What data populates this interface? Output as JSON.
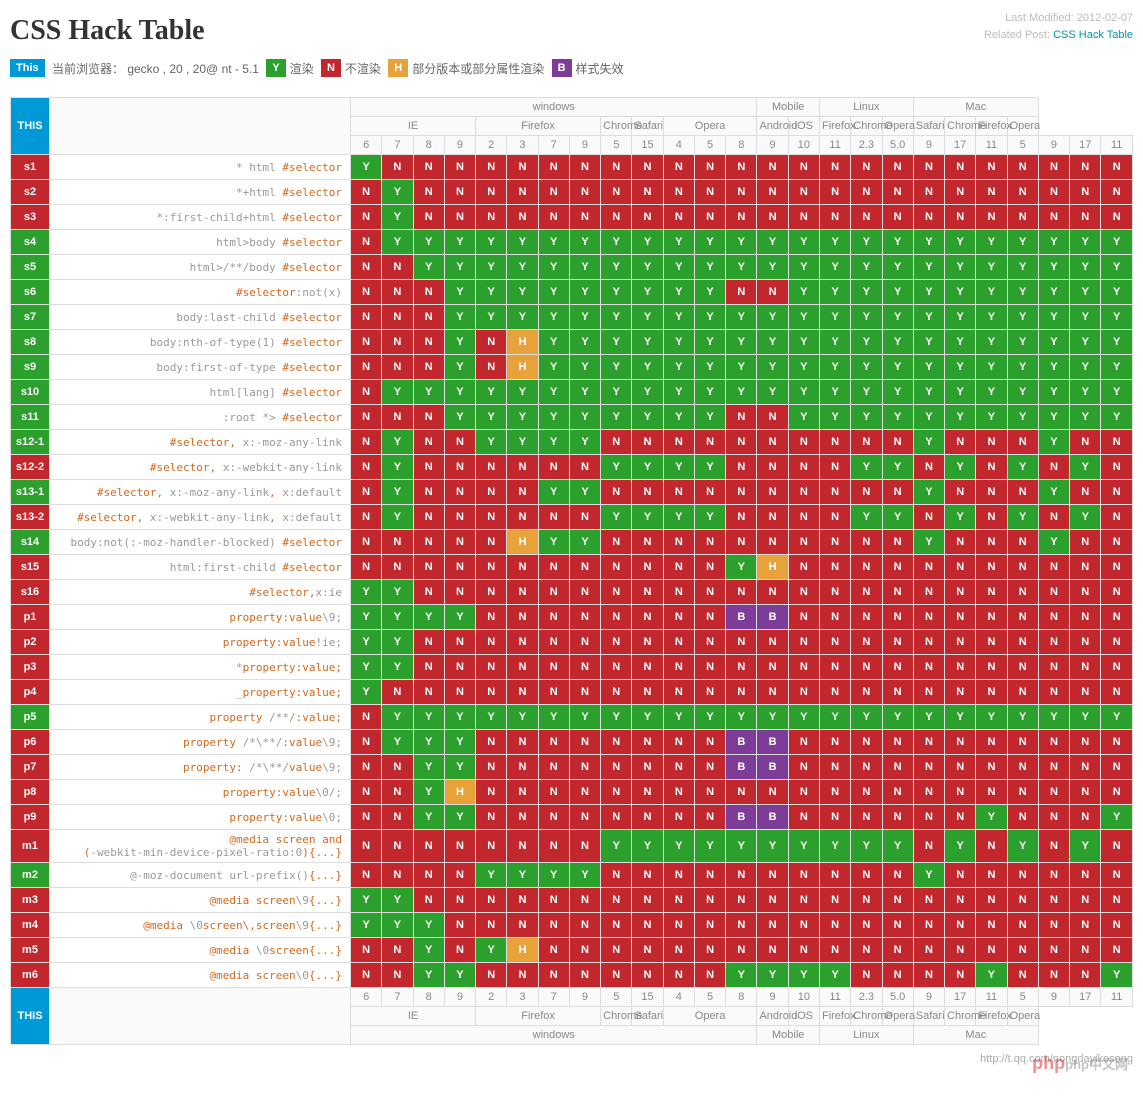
{
  "title": "CSS Hack Table",
  "meta": {
    "modified": "Last Modified: 2012-02-07",
    "related": "Related Post:",
    "link": "CSS Hack Table"
  },
  "legend": {
    "this": "This",
    "browser_label": "当前浏览器：",
    "browser_val": "gecko , 20 , 20@ nt - 5.1",
    "y": "Y",
    "y_t": "渲染",
    "n": "N",
    "n_t": "不渲染",
    "h": "H",
    "h_t": "部分版本或部分属性渲染",
    "b": "B",
    "b_t": "样式失效"
  },
  "os": [
    "windows",
    "Mobile",
    "Linux",
    "Mac"
  ],
  "os_span": [
    13,
    2,
    3,
    4
  ],
  "browsers": [
    "IE",
    "Firefox",
    "Chrome",
    "Safari",
    "Opera",
    "Android",
    "iOS",
    "Firefox",
    "Chrome",
    "Opera",
    "Safari",
    "Chrome",
    "Firefox",
    "Opera"
  ],
  "browser_span": [
    4,
    4,
    1,
    1,
    3,
    1,
    1,
    1,
    1,
    1,
    1,
    1,
    1,
    1
  ],
  "versions": [
    "6",
    "7",
    "8",
    "9",
    "2",
    "3",
    "7",
    "9",
    "5",
    "15",
    "4",
    "5",
    "8",
    "9",
    "10",
    "11",
    "2.3",
    "5.0",
    "9",
    "17",
    "11",
    "5",
    "9",
    "17",
    "11"
  ],
  "rows": [
    {
      "id": "s1",
      "c": "r",
      "hack": [
        "* html",
        " #selector"
      ],
      "v": "YNNNNNNNNNNNNNNNNNNNNNNNN"
    },
    {
      "id": "s2",
      "c": "r",
      "hack": [
        "*+html",
        " #selector"
      ],
      "v": "NYNNNNNNNNNNNNNNNNNNNNNNN"
    },
    {
      "id": "s3",
      "c": "r",
      "hack": [
        "*:first-child+html",
        " #selector"
      ],
      "v": "NYNNNNNNNNNNNNNNNNNNNNNNN"
    },
    {
      "id": "s4",
      "c": "g",
      "hack": [
        "html>body",
        " #selector"
      ],
      "v": "NYYYYYYYYYYYYYYYYYYYYYYYY"
    },
    {
      "id": "s5",
      "c": "g",
      "hack": [
        "html>/**/body",
        " #selector"
      ],
      "v": "NNYYYYYYYYYYYYYYYYYYYYYYY"
    },
    {
      "id": "s6",
      "c": "g",
      "hack": [
        "",
        "#selector",
        ":not(x)"
      ],
      "v": "NNNYYYYYYYYYNNYYYYYYYYYYY"
    },
    {
      "id": "s7",
      "c": "g",
      "hack": [
        "body:last-child",
        " #selector"
      ],
      "v": "NNNYYYYYYYYYYYYYYYYYYYYYY"
    },
    {
      "id": "s8",
      "c": "g",
      "hack": [
        "body:nth-of-type(1)",
        " #selector"
      ],
      "v": "NNNYNHYYYYYYYYYYYYYYYYYYY"
    },
    {
      "id": "s9",
      "c": "g",
      "hack": [
        "body:first-of-type",
        " #selector"
      ],
      "v": "NNNYNHYYYYYYYYYYYYYYYYYYY"
    },
    {
      "id": "s10",
      "c": "g",
      "hack": [
        "html[lang]",
        " #selector"
      ],
      "v": "NYYYYYYYYYYYYYYYYYYYYYYYY"
    },
    {
      "id": "s11",
      "c": "g",
      "hack": [
        ":root *>",
        " #selector"
      ],
      "v": "NNNYYYYYYYYYNNYYYYYYYYYYY"
    },
    {
      "id": "s12-1",
      "c": "g",
      "hack": [
        "",
        "#selector, ",
        "x:-moz-any-link"
      ],
      "v": "NYNNYYYYNNNNNNNNNNYNNNYNN"
    },
    {
      "id": "s12-2",
      "c": "r",
      "hack": [
        "",
        "#selector, ",
        "x:-webkit-any-link"
      ],
      "v": "NYNNNNNNYYYYNNNNYYNYNYNYN"
    },
    {
      "id": "s13-1",
      "c": "g",
      "hack": [
        "",
        "#selector, ",
        "x:-moz-any-link",
        ", ",
        "x:default"
      ],
      "v": "NYNNNNYYNNNNNNNNNNYNNNYNN"
    },
    {
      "id": "s13-2",
      "c": "r",
      "hack": [
        "",
        "#selector, ",
        "x:-webkit-any-link",
        ", ",
        "x:default"
      ],
      "v": "NYNNNNNNYYYYNNNNYYNYNYNYN"
    },
    {
      "id": "s14",
      "c": "g",
      "hack": [
        "body:not(:-moz-handler-blocked)",
        " #selector"
      ],
      "v": "NNNNNHYYNNNNNNNNNNYNNNYNN"
    },
    {
      "id": "s15",
      "c": "r",
      "hack": [
        "html:first-child",
        " #selector"
      ],
      "v": "NNNNNNNNNNNNYHNNNNNNNNNNN"
    },
    {
      "id": "s16",
      "c": "r",
      "hack": [
        "",
        "#selector,",
        "x:ie"
      ],
      "v": "YYNNNNNNNNNNNNNNNNNNNNNNN"
    },
    {
      "id": "p1",
      "c": "r",
      "hack": [
        "",
        "property:value",
        "\\9;"
      ],
      "v": "YYYYNNNNNNNNBBNNNNNNNNNNN"
    },
    {
      "id": "p2",
      "c": "r",
      "hack": [
        "",
        "property:value",
        "!ie;"
      ],
      "v": "YYNNNNNNNNNNNNNNNNNNNNNNN"
    },
    {
      "id": "p3",
      "c": "r",
      "hack": [
        "*",
        "property:value;"
      ],
      "v": "YYNNNNNNNNNNNNNNNNNNNNNNN"
    },
    {
      "id": "p4",
      "c": "r",
      "hack": [
        "_",
        "property:value;"
      ],
      "v": "YNNNNNNNNNNNNNNNNNNNNNNNN"
    },
    {
      "id": "p5",
      "c": "g",
      "hack": [
        "",
        "property ",
        "/**/",
        ":value;"
      ],
      "v": "NYYYYYYYYYYYYYYYYYYYYYYYY"
    },
    {
      "id": "p6",
      "c": "r",
      "hack": [
        "",
        "property ",
        "/*\\**/",
        ":value",
        "\\9;"
      ],
      "v": "NYYYNNNNNNNNBBNNNNNNNNNNN"
    },
    {
      "id": "p7",
      "c": "r",
      "hack": [
        "",
        "property: ",
        "/*\\**/",
        "value",
        "\\9;"
      ],
      "v": "NNYYNNNNNNNNBBNNNNNNNNNNN"
    },
    {
      "id": "p8",
      "c": "r",
      "hack": [
        "",
        "property:value",
        "\\0/;"
      ],
      "v": "NNYHNNNNNNNNNNNNNNNNNNNNN"
    },
    {
      "id": "p9",
      "c": "r",
      "hack": [
        "",
        "property:value",
        "\\0;"
      ],
      "v": "NNYYNNNNNNNNBBNNNNNNYNNNY"
    },
    {
      "id": "m1",
      "c": "r",
      "hack": [
        "",
        "@media screen and<br>(",
        "-webkit-min-device-pixel-ratio:0",
        "){...}"
      ],
      "v": "NNNNNNNNYYYYYYYYYYNYNYNYN"
    },
    {
      "id": "m2",
      "c": "g",
      "hack": [
        "@-moz-document url-prefix()",
        "{...}"
      ],
      "v": "NNNNYYYYNNNNNNNNNNYNNNNNN"
    },
    {
      "id": "m3",
      "c": "r",
      "hack": [
        "",
        "@media screen",
        "\\9",
        "{...}"
      ],
      "v": "YYNNNNNNNNNNNNNNNNNNNNNNN"
    },
    {
      "id": "m4",
      "c": "r",
      "hack": [
        "",
        "@media ",
        "\\0",
        "screen\\,screen",
        "\\9",
        "{...}"
      ],
      "v": "YYYNNNNNNNNNNNNNNNNNNNNNN"
    },
    {
      "id": "m5",
      "c": "r",
      "hack": [
        "",
        "@media ",
        "\\0",
        "screen{...}"
      ],
      "v": "NNYNYHNNNNNNNNNNNNNNNNNNN"
    },
    {
      "id": "m6",
      "c": "r",
      "hack": [
        "",
        "@media screen",
        "\\0",
        "{...}"
      ],
      "v": "NNYYNNNNNNNNYYYYNNNNYNNNY"
    }
  ],
  "footer": "http://t.qq.com/nongdayikesong",
  "wm": "php中文网"
}
